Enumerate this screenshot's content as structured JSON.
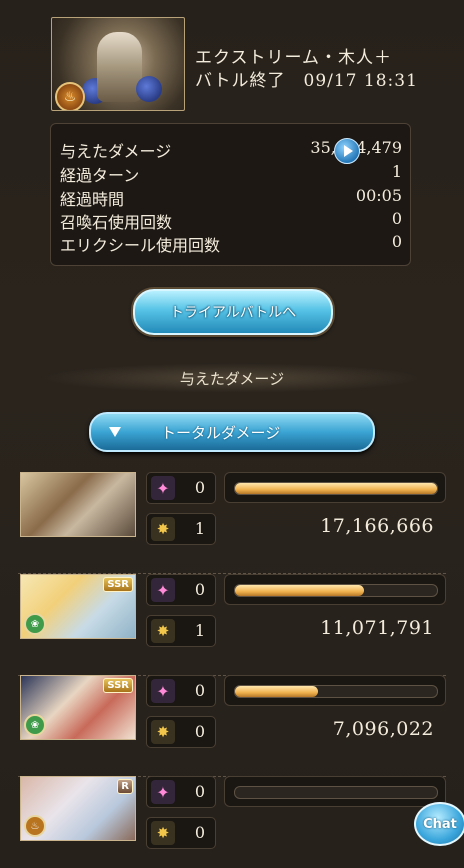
{
  "header": {
    "quest_title": "エクストリーム・木人＋",
    "battle_end": "バトル終了　09/17 18:31",
    "element_icon": "fire-element-icon"
  },
  "stats": {
    "rows": [
      {
        "label": "与えたダメージ",
        "value": "35,334,479"
      },
      {
        "label": "経過ターン",
        "value": "1"
      },
      {
        "label": "経過時間",
        "value": "00:05"
      },
      {
        "label": "召喚石使用回数",
        "value": "0"
      },
      {
        "label": "エリクシール使用回数",
        "value": "0"
      }
    ]
  },
  "trial_button": "トライアルバトルへ",
  "section_header": "与えたダメージ",
  "total_dropdown": "トータルダメージ",
  "characters": [
    {
      "rarity": "",
      "element": "",
      "skill_count": "0",
      "ougi_count": "1",
      "bar_fraction": 1.0,
      "damage": "17,166,666"
    },
    {
      "rarity": "SSR",
      "element": "wind",
      "skill_count": "0",
      "ougi_count": "1",
      "bar_fraction": 0.64,
      "damage": "11,071,791"
    },
    {
      "rarity": "SSR",
      "element": "wind",
      "skill_count": "0",
      "ougi_count": "0",
      "bar_fraction": 0.41,
      "damage": "7,096,022"
    },
    {
      "rarity": "R",
      "element": "fire",
      "skill_count": "0",
      "ougi_count": "0",
      "bar_fraction": 0.0,
      "damage": ""
    }
  ],
  "chat_button": "Chat",
  "colors": {
    "accent_blue": "#3ba4d3",
    "bar_gold": "#f0b24e",
    "background": "#27211b"
  }
}
